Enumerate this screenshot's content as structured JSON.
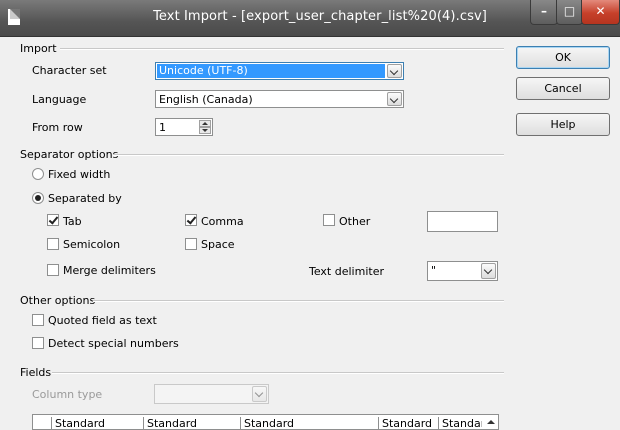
{
  "window": {
    "title": "Text Import - [export_user_chapter_list%20(4).csv]"
  },
  "import": {
    "group_label": "Import",
    "character_set_label": "Character set",
    "character_set_value": "Unicode (UTF-8)",
    "language_label": "Language",
    "language_value": "English (Canada)",
    "from_row_label": "From row",
    "from_row_value": "1"
  },
  "separator": {
    "group_label": "Separator options",
    "fixed_width": {
      "label": "Fixed width",
      "selected": false
    },
    "separated_by": {
      "label": "Separated by",
      "selected": true
    },
    "tab": {
      "label": "Tab",
      "checked": true
    },
    "comma": {
      "label": "Comma",
      "checked": true
    },
    "other": {
      "label": "Other",
      "checked": false
    },
    "semicolon": {
      "label": "Semicolon",
      "checked": false
    },
    "space": {
      "label": "Space",
      "checked": false
    },
    "merge_delimiters": {
      "label": "Merge delimiters",
      "checked": false
    },
    "text_delimiter_label": "Text delimiter",
    "text_delimiter_value": "\""
  },
  "other_options": {
    "group_label": "Other options",
    "quoted_field": {
      "label": "Quoted field as text",
      "checked": false
    },
    "detect_numbers": {
      "label": "Detect special numbers",
      "checked": false
    }
  },
  "fields": {
    "group_label": "Fields",
    "column_type_label": "Column type",
    "column_type_value": "",
    "columns": [
      "Standard",
      "Standard",
      "Standard",
      "Standard",
      "Standard"
    ]
  },
  "buttons": {
    "ok": "OK",
    "cancel": "Cancel",
    "help": "Help"
  },
  "colors": {
    "selection": "#3399ff",
    "close_button": "#c6402a"
  }
}
